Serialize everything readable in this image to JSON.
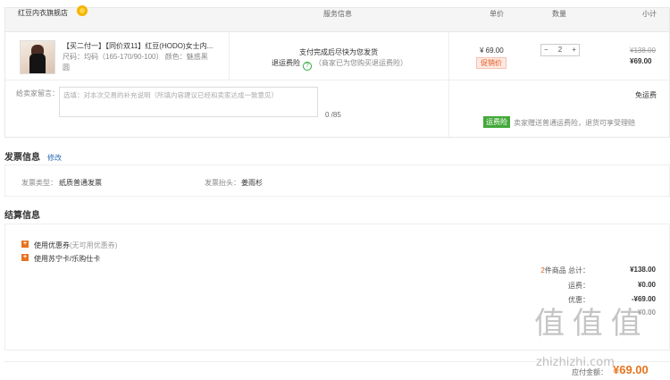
{
  "header": {
    "store_name": "红豆内衣旗舰店",
    "col_service": "服务信息",
    "col_price": "单价",
    "col_qty": "数量",
    "col_subtotal": "小计"
  },
  "product": {
    "title": "【买二付一】【同价双11】红豆(HODO)女士内...",
    "spec": "尺码：均码（165-170/90-100）   颜色：魅惑黑",
    "spec_tail": "圆",
    "service_line1": "支付完成后尽快为您发货",
    "service_label": "退运费险",
    "service_note": "（商家已为您购买退运费险）",
    "unit_price": "¥ 69.00",
    "promo_tag": "促销价",
    "qty": "2",
    "minus": "−",
    "plus": "+",
    "orig_price": "¥138.00",
    "sub_price": "¥69.00"
  },
  "message": {
    "label": "给卖家留言：",
    "placeholder": "选填：对本次交易的补充说明（所填内容建议已经和卖家达成一致意见）",
    "count": "0 /85",
    "free_ship": "免运费",
    "ins_tag": "运费险",
    "ins_text": "卖家赠送普通运费险，退货可享受理赔"
  },
  "invoice": {
    "title": "发票信息",
    "edit": "修改",
    "type_label": "发票类型：",
    "type_value": "纸质普通发票",
    "head_label": "发票抬头：",
    "head_value": "姜雨杉"
  },
  "settlement": {
    "title": "结算信息",
    "coupon_label": "使用优惠券",
    "coupon_note": "(无可用优惠券)",
    "card_label": "使用苏宁卡/乐购仕卡",
    "count_num": "2",
    "count_label": "件商品 总计：",
    "total": "¥138.00",
    "freight_label": "运费：",
    "freight": "¥0.00",
    "discount_label": "优惠：",
    "discount": "-¥69.00",
    "extra_value": "¥0.00",
    "pay_label": "应付金额：",
    "pay_value": "¥69.00"
  },
  "watermark": {
    "logo": "值 值 值",
    "text": "zhizhizhi.com"
  }
}
